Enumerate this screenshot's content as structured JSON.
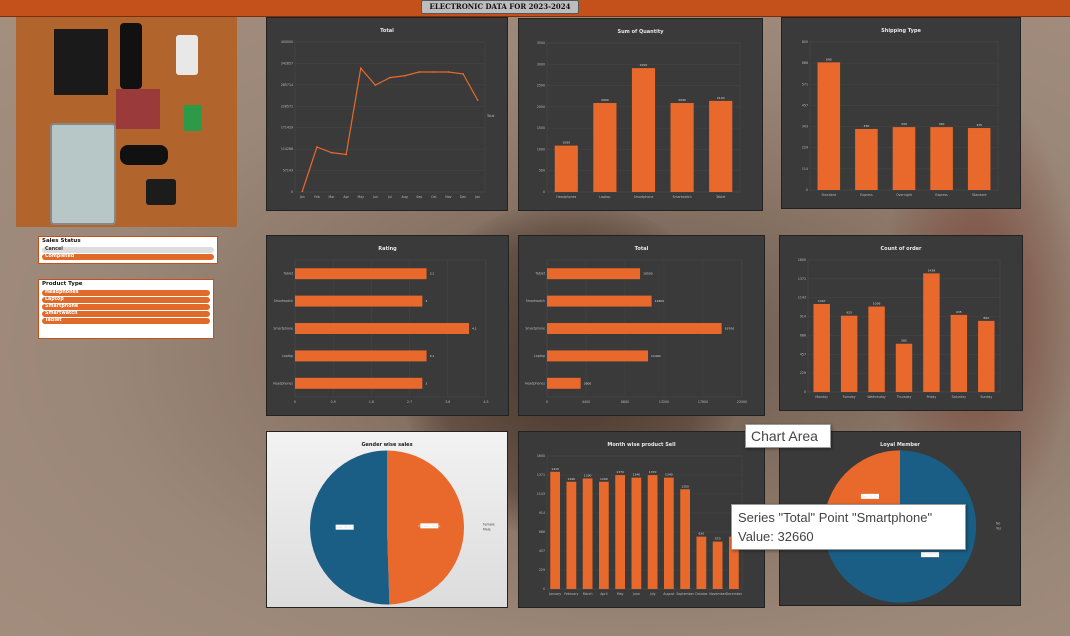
{
  "header": {
    "title": "ELECTRONIC DATA FOR 2023-2024"
  },
  "slicers": [
    {
      "title": "Sales Status",
      "items": [
        {
          "label": "Cancel",
          "selected": false
        },
        {
          "label": "Completed",
          "selected": true
        }
      ]
    },
    {
      "title": "Product Type",
      "items": [
        {
          "label": "Headphones",
          "selected": true
        },
        {
          "label": "Laptop",
          "selected": true
        },
        {
          "label": "Smartphone",
          "selected": true
        },
        {
          "label": "Smartwatch",
          "selected": true
        },
        {
          "label": "Tablet",
          "selected": true
        }
      ]
    }
  ],
  "tooltips": {
    "chart_area": "Chart Area",
    "point_line1": "Series \"Total\" Point \"Smartphone\"",
    "point_line2": "Value: 32660"
  },
  "colors": {
    "bar": "#e8692b",
    "pie_blue": "#1b5e85",
    "pie_orange": "#e8692b",
    "line": "#e8692b",
    "header": "#c4501b"
  },
  "chart_data": [
    {
      "id": "c1",
      "type": "line",
      "title": "Total",
      "x": [
        "Jan",
        "Feb",
        "Mar",
        "Apr",
        "May",
        "Jun",
        "Jul",
        "Aug",
        "Sep",
        "Oct",
        "Nov",
        "Dec",
        "Jan"
      ],
      "series": [
        {
          "name": "Total",
          "values": [
            2000,
            120000,
            105000,
            100000,
            330000,
            285000,
            305000,
            310000,
            320000,
            320000,
            320000,
            315000,
            245000
          ]
        }
      ],
      "ylim": [
        0,
        400000
      ]
    },
    {
      "id": "c2",
      "type": "bar",
      "title": "Sum of Quantity",
      "categories": [
        "Headphones",
        "Laptop",
        "Smartphone",
        "Smartwatch",
        "Tablet"
      ],
      "values": [
        1090,
        2090,
        2910,
        2090,
        2140
      ],
      "ylim": [
        0,
        3500
      ]
    },
    {
      "id": "c3",
      "type": "bar",
      "title": "Shipping Type",
      "categories": [
        "Standard",
        "Express",
        "Overnight",
        "Express",
        "Standard"
      ],
      "values": [
        690,
        330,
        340,
        340,
        335
      ],
      "ylim": [
        0,
        800
      ]
    },
    {
      "id": "c4",
      "type": "bar",
      "orientation": "horizontal",
      "title": "Rating",
      "categories": [
        "Tablet",
        "Smartwatch",
        "Smartphone",
        "Laptop",
        "Headphones"
      ],
      "values": [
        3.1,
        3.0,
        4.1,
        3.1,
        3.0
      ],
      "xlim": [
        0,
        4.5
      ]
    },
    {
      "id": "c5",
      "type": "bar",
      "orientation": "horizontal",
      "title": "Total",
      "categories": [
        "Tablet",
        "Smartwatch",
        "Smartphone",
        "Laptop",
        "Headphones"
      ],
      "values": [
        10500,
        11800,
        19700,
        11400,
        3800
      ],
      "xlim": [
        0,
        22000
      ]
    },
    {
      "id": "c6",
      "type": "bar",
      "title": "Count of order",
      "categories": [
        "Monday",
        "Tuesday",
        "Wednesday",
        "Thursday",
        "Friday",
        "Saturday",
        "Sunday"
      ],
      "values": [
        1067,
        925,
        1036,
        585,
        1438,
        935,
        862
      ],
      "ylim": [
        0,
        1600
      ]
    },
    {
      "id": "c7",
      "type": "pie",
      "title": "Gender wise sales",
      "categories": [
        "Female",
        "Male"
      ],
      "values": [
        49.5,
        50.5
      ],
      "labels": [
        "49.5%",
        "50.5%"
      ]
    },
    {
      "id": "c8",
      "type": "bar",
      "title": "Month wise product Sell",
      "categories": [
        "January",
        "February",
        "March",
        "April",
        "May",
        "June",
        "July",
        "August",
        "September",
        "October",
        "November",
        "December"
      ],
      "values": [
        1410,
        1290,
        1330,
        1290,
        1370,
        1340,
        1370,
        1340,
        1200,
        630,
        570,
        630
      ],
      "ylim": [
        0,
        1600
      ]
    },
    {
      "id": "c9",
      "type": "pie",
      "title": "Loyal Member",
      "categories": [
        "No",
        "Yes"
      ],
      "values": [
        74.5,
        25.5
      ],
      "labels": [
        "74.5%",
        "25.5%"
      ]
    }
  ]
}
